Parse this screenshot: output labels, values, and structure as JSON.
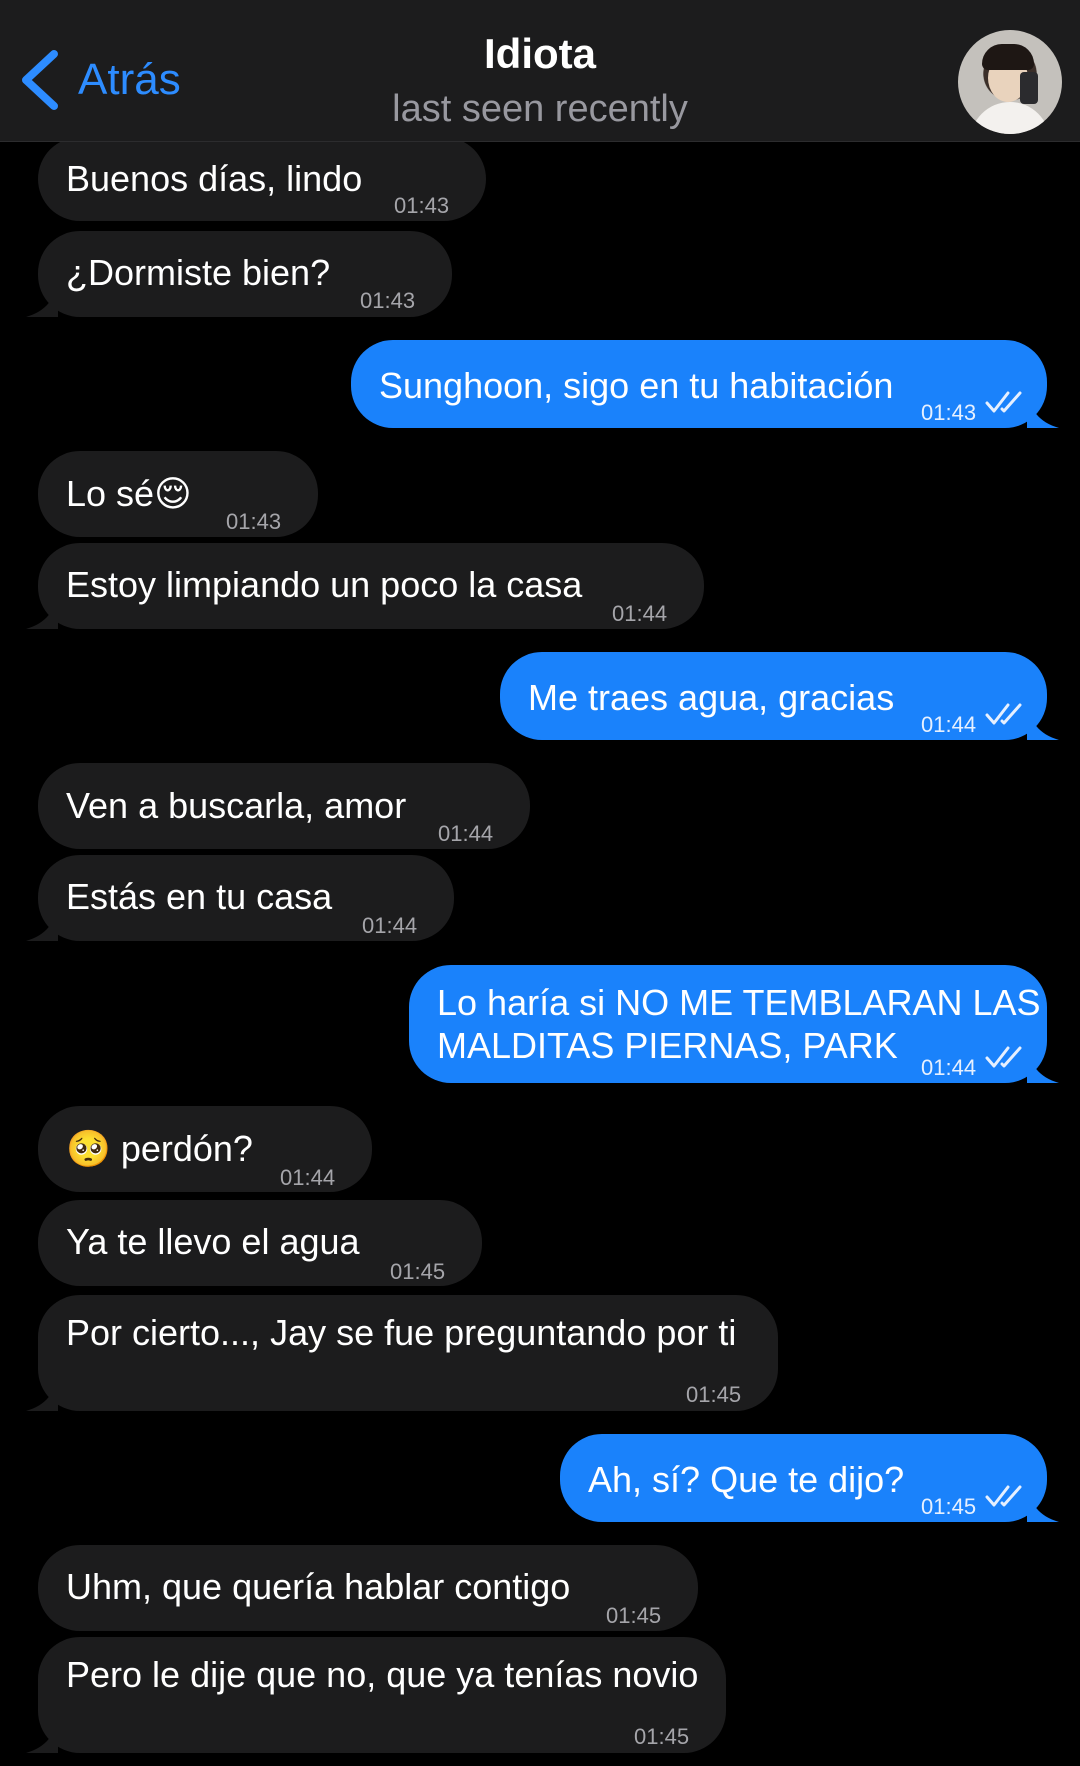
{
  "header": {
    "back_label": "Atrás",
    "title": "Idiota",
    "subtitle": "last seen recently"
  },
  "colors": {
    "incoming": "#1c1c1d",
    "outgoing": "#1a82fb",
    "accent": "#2d8cff",
    "background": "#000000"
  },
  "messages": [
    {
      "direction": "in",
      "text": "Buenos días, lindo",
      "time": "01:43"
    },
    {
      "direction": "in",
      "text": "¿Dormiste bien?",
      "time": "01:43"
    },
    {
      "direction": "out",
      "text": "Sunghoon, sigo en tu habitación",
      "time": "01:43",
      "read": true
    },
    {
      "direction": "in",
      "text": "Lo sé😌",
      "time": "01:43"
    },
    {
      "direction": "in",
      "text": "Estoy limpiando un poco la casa",
      "time": "01:44"
    },
    {
      "direction": "out",
      "text": "Me traes agua, gracias",
      "time": "01:44",
      "read": true
    },
    {
      "direction": "in",
      "text": "Ven a buscarla, amor",
      "time": "01:44"
    },
    {
      "direction": "in",
      "text": "Estás en tu casa",
      "time": "01:44"
    },
    {
      "direction": "out",
      "text_lines": [
        "Lo haría si NO ME TEMBLARAN LAS",
        "MALDITAS PIERNAS, PARK"
      ],
      "time": "01:44",
      "read": true
    },
    {
      "direction": "in",
      "text": "🥺 perdón?",
      "time": "01:44"
    },
    {
      "direction": "in",
      "text": "Ya te llevo el agua",
      "time": "01:45"
    },
    {
      "direction": "in",
      "text": "Por cierto..., Jay se fue preguntando por ti",
      "time": "01:45"
    },
    {
      "direction": "out",
      "text": "Ah, sí? Que te dijo?",
      "time": "01:45",
      "read": true
    },
    {
      "direction": "in",
      "text": "Uhm, que quería hablar contigo",
      "time": "01:45"
    },
    {
      "direction": "in",
      "text": "Pero le dije que no, que ya tenías novio",
      "time": "01:45"
    }
  ]
}
